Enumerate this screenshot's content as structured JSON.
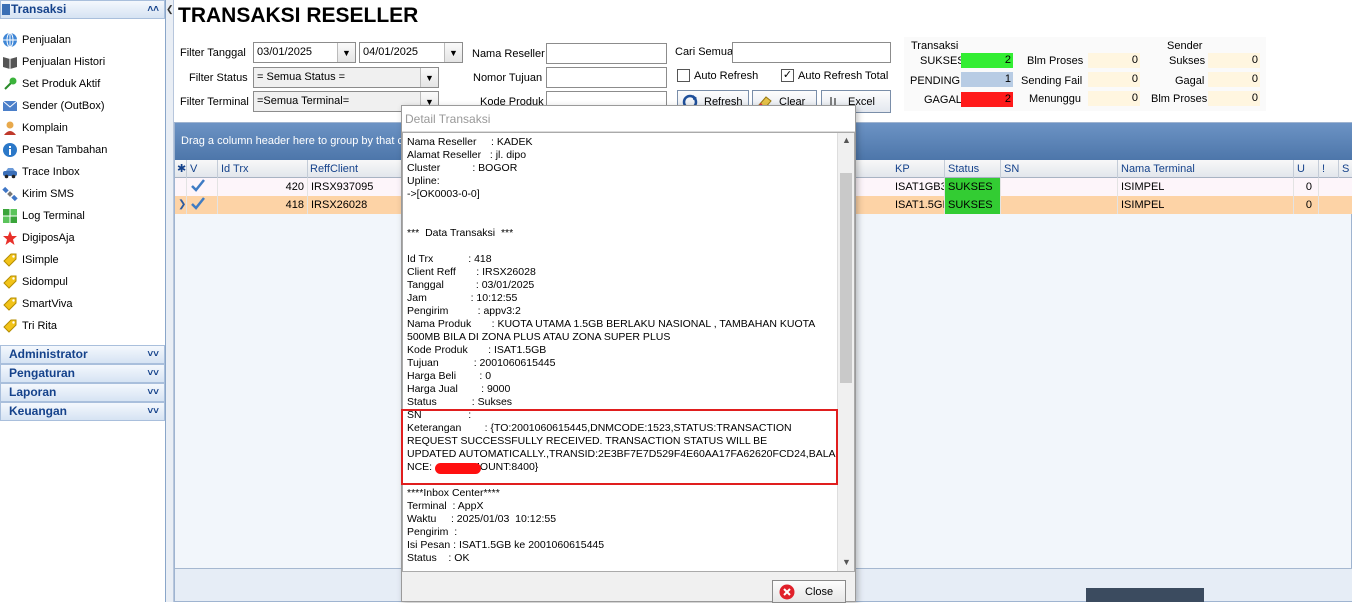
{
  "sidebar": {
    "groups": {
      "transaksi": "Transaksi",
      "administrator": "Administrator",
      "pengaturan": "Pengaturan",
      "laporan": "Laporan",
      "keuangan": "Keuangan"
    },
    "items": [
      {
        "label": "Penjualan",
        "icon": "globe-icon"
      },
      {
        "label": "Penjualan Histori",
        "icon": "book-icon"
      },
      {
        "label": "Set Produk Aktif",
        "icon": "pin-icon"
      },
      {
        "label": "Sender (OutBox)",
        "icon": "mail-icon"
      },
      {
        "label": "Komplain",
        "icon": "user-icon"
      },
      {
        "label": "Pesan Tambahan",
        "icon": "info-icon"
      },
      {
        "label": "Trace Inbox",
        "icon": "car-icon"
      },
      {
        "label": "Kirim SMS",
        "icon": "satellite-icon"
      },
      {
        "label": "Log Terminal",
        "icon": "puzzle-icon"
      },
      {
        "label": "DigiposAja",
        "icon": "star-icon"
      },
      {
        "label": "ISimple",
        "icon": "tag-icon"
      },
      {
        "label": "Sidompul",
        "icon": "tag-icon"
      },
      {
        "label": "SmartViva",
        "icon": "tag-icon"
      },
      {
        "label": "Tri Rita",
        "icon": "tag-icon"
      }
    ]
  },
  "main": {
    "title": "TRANSAKSI RESELLER",
    "filters": {
      "tanggal_label": "Filter Tanggal",
      "tanggal_from": "03/01/2025",
      "tanggal_to": "04/01/2025",
      "status_label": "Filter Status",
      "status_value": "= Semua Status =",
      "terminal_label": "Filter Terminal",
      "terminal_value": "=Semua Terminal=",
      "nama_reseller_label": "Nama Reseller",
      "nomor_tujuan_label": "Nomor Tujuan",
      "kode_produk_label": "Kode Produk",
      "cari_semua_label": "Cari Semua",
      "auto_refresh_label": "Auto Refresh",
      "auto_refresh_total_label": "Auto Refresh Total",
      "refresh_button": "Refresh",
      "clear_button": "Clear",
      "excel_button": "Excel"
    },
    "stats": {
      "transaksi_header": "Transaksi",
      "sender_header": "Sender",
      "sukses_label": "SUKSES",
      "sukses_value": "2",
      "pending_label": "PENDING",
      "pending_value": "1",
      "gagal_label": "GAGAL",
      "gagal_value": "2",
      "blm_proses_label": "Blm Proses",
      "blm_proses_value": "0",
      "sending_fail_label": "Sending Fail",
      "sending_fail_value": "0",
      "menunggu_label": "Menunggu",
      "menunggu_value": "0",
      "s_sukses_label": "Sukses",
      "s_sukses_value": "0",
      "s_gagal_label": "Gagal",
      "s_gagal_value": "0",
      "s_blm_proses_label": "Blm Proses",
      "s_blm_proses_value": "0",
      "colors": {
        "sukses": "#33ee33",
        "pending": "#b8cce4",
        "gagal": "#ff1a1a"
      }
    },
    "grid": {
      "group_hint": "Drag a column header here to group by that c",
      "columns": {
        "v": "V",
        "id_trx": "Id Trx",
        "reff_client": "ReffClient",
        "kp": "KP",
        "status": "Status",
        "sn": "SN",
        "nama_terminal": "Nama Terminal",
        "u": "U",
        "excl": "!",
        "s": "S"
      },
      "rows": [
        {
          "id_trx": "420",
          "reff_client": "IRSX937095",
          "kp": "ISAT1GB3",
          "status": "SUKSES",
          "nama_terminal": "ISIMPEL",
          "u": "0"
        },
        {
          "id_trx": "418",
          "reff_client": "IRSX26028",
          "kp": "ISAT1.5GI",
          "status": "SUKSES",
          "nama_terminal": "ISIMPEL",
          "u": "0"
        }
      ]
    }
  },
  "dialog": {
    "title": "Detail Transaksi",
    "lines": [
      "Nama Reseller     : KADEK",
      "Alamat Reseller   : jl. dipo",
      "Cluster           : BOGOR",
      "Upline:",
      "->[OK0003-0-0]",
      "",
      "",
      "***  Data Transaksi  ***",
      "",
      "Id Trx            : 418",
      "Client Reff       : IRSX26028",
      "Tanggal           : 03/01/2025",
      "Jam               : 10:12:55",
      "Pengirim          : appv3:2",
      "Nama Produk       : KUOTA UTAMA 1.5GB BERLAKU NASIONAL , TAMBAHAN KUOTA",
      "500MB BILA DI ZONA PLUS ATAU ZONA SUPER PLUS",
      "Kode Produk       : ISAT1.5GB",
      "Tujuan            : 2001060615445",
      "Harga Beli        : 0",
      "Harga Jual        : 9000",
      "Status            : Sukses",
      "SN                :",
      "Keterangan        : {TO:2001060615445,DNMCODE:1523,STATUS:TRANSACTION",
      "REQUEST SUCCESSFULLY RECEIVED. TRANSACTION STATUS WILL BE",
      "UPDATED AUTOMATICALLY.,TRANSID:2E3BF7E7D529F4E60AA17FA62620FCD24,BALA",
      "NCE:        0,AMOUNT:8400}",
      "",
      "****Inbox Center****",
      "Terminal  : AppX",
      "Waktu     : 2025/01/03  10:12:55",
      "Pengirim  :",
      "Isi Pesan : ISAT1.5GB ke 2001060615445",
      "Status    : OK"
    ],
    "close_button": "Close"
  }
}
